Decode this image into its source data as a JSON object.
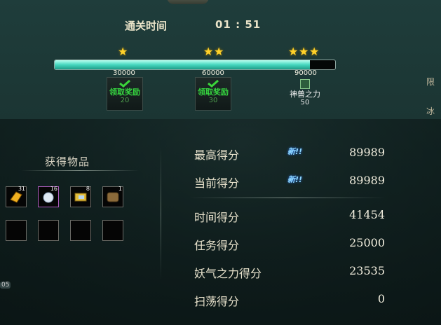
{
  "clear_time": {
    "label": "通关时间",
    "value": "01 : 51"
  },
  "progress": {
    "fraction": 0.91,
    "thresholds": [
      "30000",
      "60000",
      "90000"
    ],
    "stars": [
      1,
      2,
      3
    ]
  },
  "milestones": [
    {
      "label": "领取奖励",
      "count": "20",
      "state": "claimed"
    },
    {
      "label": "领取奖励",
      "count": "30",
      "state": "claimed"
    },
    {
      "label": "神兽之力",
      "count": "50",
      "state": "pending"
    }
  ],
  "items_panel": {
    "title": "获得物品",
    "items": [
      {
        "icon": "gold-ingot-icon",
        "qty": "31"
      },
      {
        "icon": "silver-orb-icon",
        "qty": "16"
      },
      {
        "icon": "gold-scroll-icon",
        "qty": "8"
      },
      {
        "icon": "leather-item-icon",
        "qty": "1"
      },
      {
        "icon": "empty-slot",
        "qty": ""
      },
      {
        "icon": "empty-slot",
        "qty": ""
      },
      {
        "icon": "empty-slot",
        "qty": ""
      },
      {
        "icon": "empty-slot",
        "qty": ""
      }
    ]
  },
  "scores": {
    "best": {
      "label": "最高得分",
      "value": "89989",
      "badge": "新!!"
    },
    "current": {
      "label": "当前得分",
      "value": "89989",
      "badge": "新!!"
    },
    "time": {
      "label": "时间得分",
      "value": "41454"
    },
    "task": {
      "label": "任务得分",
      "value": "25000"
    },
    "demon": {
      "label": "妖气之力得分",
      "value": "23535"
    },
    "sweep": {
      "label": "扫荡得分",
      "value": "0"
    }
  },
  "right_edge": {
    "deco1": "限",
    "deco2": "冰",
    "deco3": "冰"
  },
  "hud": {
    "badge": "05"
  },
  "colors": {
    "accent": "#45d7bf",
    "gold": "#ffd22a",
    "green": "#35d43f",
    "new_badge": "#8fd8ff"
  }
}
